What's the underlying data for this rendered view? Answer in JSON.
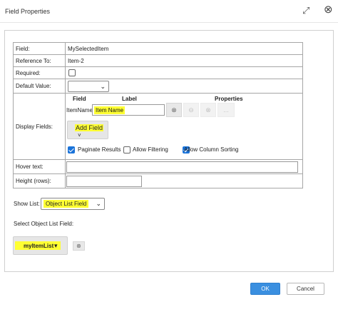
{
  "window": {
    "title": "Field Properties",
    "maximize_icon": "⤢",
    "close_icon": "⊗"
  },
  "rows": {
    "field": {
      "label": "Field:",
      "value": "MySelectedItem"
    },
    "reference": {
      "label": "Reference To:",
      "value": "Item-2"
    },
    "required": {
      "label": "Required:",
      "checked": false
    },
    "default_value": {
      "label": "Default Value:",
      "value": ""
    },
    "display_fields": {
      "label": "Display Fields:",
      "col_field": "Field",
      "col_label": "Label",
      "col_properties": "Properties",
      "item_field": "ItemName",
      "item_label": "Item Name",
      "add_field_label": "Add Field",
      "add_field_caret": "˅",
      "paginate_label": "Paginate Results",
      "paginate_checked": true,
      "filtering_label": "Allow Filtering",
      "filtering_checked": false,
      "sorting_label": "Allow Column Sorting",
      "sorting_checked": true,
      "props_glyphs": [
        "⊗",
        "⊖",
        "⊗",
        "..."
      ]
    },
    "hover_text": {
      "label": "Hover text:",
      "value": ""
    },
    "height_rows": {
      "label": "Height (rows):",
      "value": ""
    }
  },
  "show_list": {
    "label": "Show List:",
    "value": "Object List Field"
  },
  "select_object_list": {
    "label": "Select Object List Field:",
    "value": "myItemList",
    "caret": "▾",
    "clear_icon": "⊗"
  },
  "caret_glyph": "⌄",
  "footer": {
    "ok_label": "OK",
    "cancel_label": "Cancel"
  },
  "colors": {
    "highlight": "#ffff33",
    "primary": "#3a8fe0",
    "checkbox_on": "#1a73d9"
  }
}
